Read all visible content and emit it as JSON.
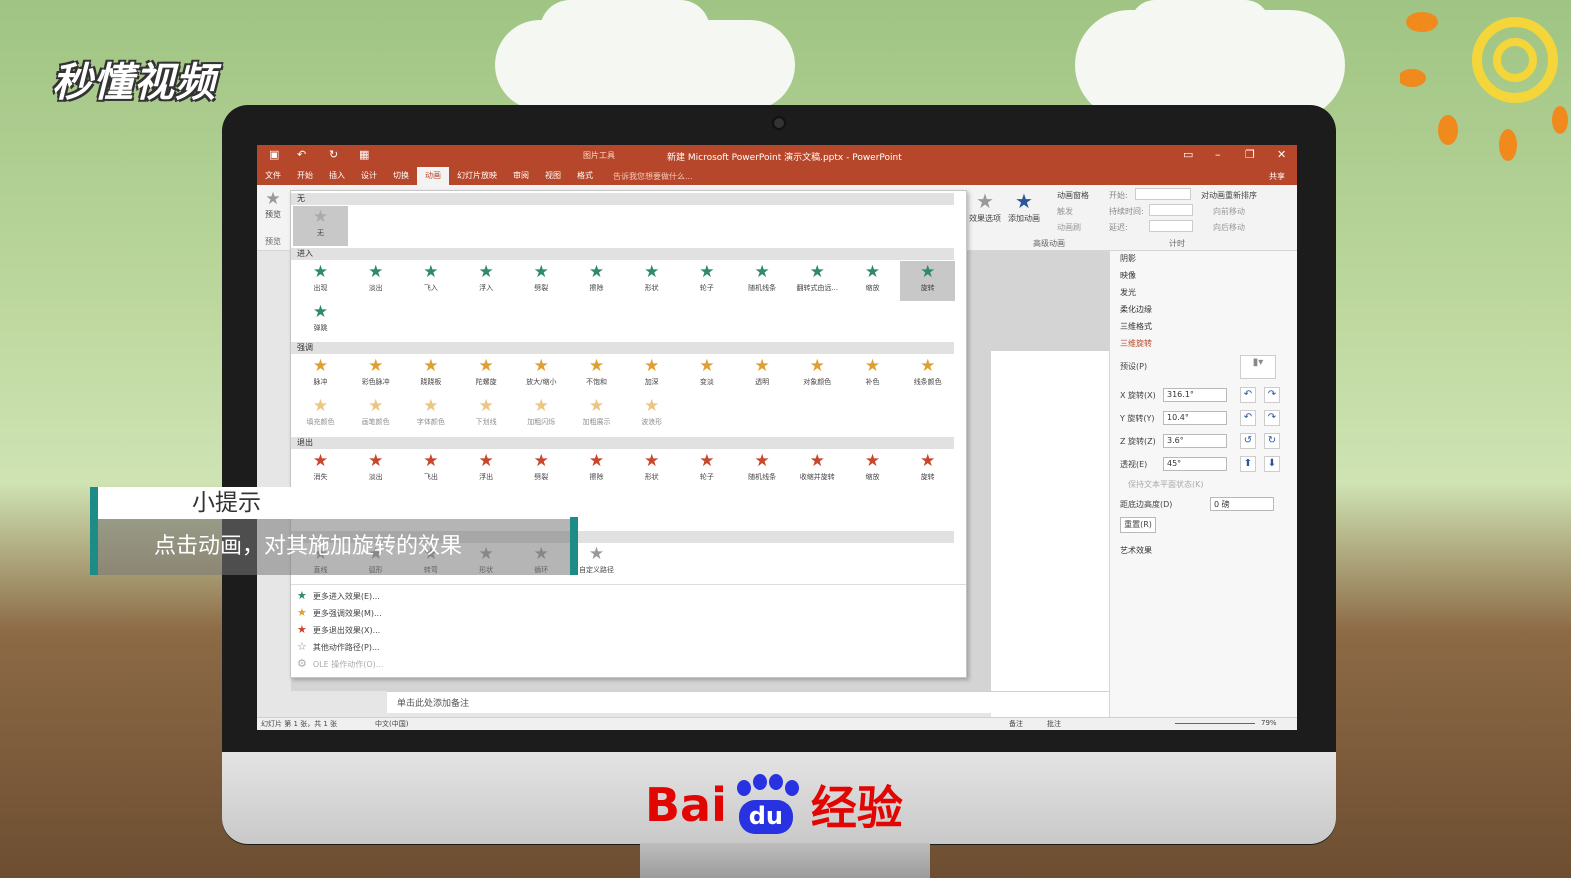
{
  "overlay": {
    "brand": "秒懂视频",
    "tip_title": "小提示",
    "tip_text": "点击动画，对其施加旋转的效果",
    "baidu": {
      "left": "Bai",
      "du": "du",
      "right": "经验"
    }
  },
  "window": {
    "title": "新建 Microsoft PowerPoint 演示文稿.pptx - PowerPoint",
    "context_tab": "图片工具",
    "share": "共享"
  },
  "tabs": [
    "文件",
    "开始",
    "插入",
    "设计",
    "切换",
    "动画",
    "幻灯片放映",
    "审阅",
    "视图",
    "格式"
  ],
  "active_tab": "动画",
  "tell_me": "告诉我您想要做什么...",
  "ribbon": {
    "preview": "预览",
    "preview_group": "预览",
    "effect_options": "效果选项",
    "add_animation": "添加动画",
    "animation_pane": "动画窗格",
    "trigger": "触发",
    "animation_painter": "动画刷",
    "advanced_group": "高级动画",
    "start_label": "开始:",
    "duration_label": "持续时间:",
    "delay_label": "延迟:",
    "timing_group": "计时",
    "reorder": "对动画重新排序",
    "move_earlier": "向前移动",
    "move_later": "向后移动"
  },
  "gallery": {
    "none_header": "无",
    "none_item": "无",
    "entrance_header": "进入",
    "entrance": [
      "出现",
      "淡出",
      "飞入",
      "浮入",
      "劈裂",
      "擦除",
      "形状",
      "轮子",
      "随机线条",
      "翻转式由远...",
      "缩放",
      "旋转",
      "弹跳"
    ],
    "emphasis_header": "强调",
    "emphasis": [
      "脉冲",
      "彩色脉冲",
      "跷跷板",
      "陀螺旋",
      "放大/缩小",
      "不饱和",
      "加深",
      "变淡",
      "透明",
      "对象颜色",
      "补色",
      "线条颜色",
      "填充颜色",
      "画笔颜色",
      "字体颜色",
      "下划线",
      "加粗闪烁",
      "加粗展示",
      "波浪形"
    ],
    "exit_header": "退出",
    "exit": [
      "消失",
      "淡出",
      "飞出",
      "浮出",
      "劈裂",
      "擦除",
      "形状",
      "轮子",
      "随机线条",
      "收缩并旋转",
      "缩放",
      "旋转"
    ],
    "paths": [
      "直线",
      "弧形",
      "转弯",
      "形状",
      "循环",
      "自定义路径"
    ],
    "more": [
      "更多进入效果(E)...",
      "更多强调效果(M)...",
      "更多退出效果(X)...",
      "其他动作路径(P)...",
      "OLE 操作动作(O)..."
    ]
  },
  "format_pane": {
    "sections": [
      "阴影",
      "映像",
      "发光",
      "柔化边缘",
      "三维格式",
      "三维旋转"
    ],
    "active_section": "三维旋转",
    "preset_label": "预设(P)",
    "x_label": "X 旋转(X)",
    "x_value": "316.1°",
    "y_label": "Y 旋转(Y)",
    "y_value": "10.4°",
    "z_label": "Z 旋转(Z)",
    "z_value": "3.6°",
    "persp_label": "透视(E)",
    "persp_value": "45°",
    "keep_flat": "保持文本平面状态(K)",
    "dist_label": "距底边高度(D)",
    "dist_value": "0 磅",
    "reset": "重置(R)",
    "art_effects": "艺术效果"
  },
  "notes_placeholder": "单击此处添加备注",
  "status": {
    "slide": "幻灯片 第 1 张，共 1 张",
    "lang": "中文(中国)",
    "notes": "备注",
    "comments": "批注",
    "zoom": "79%"
  }
}
